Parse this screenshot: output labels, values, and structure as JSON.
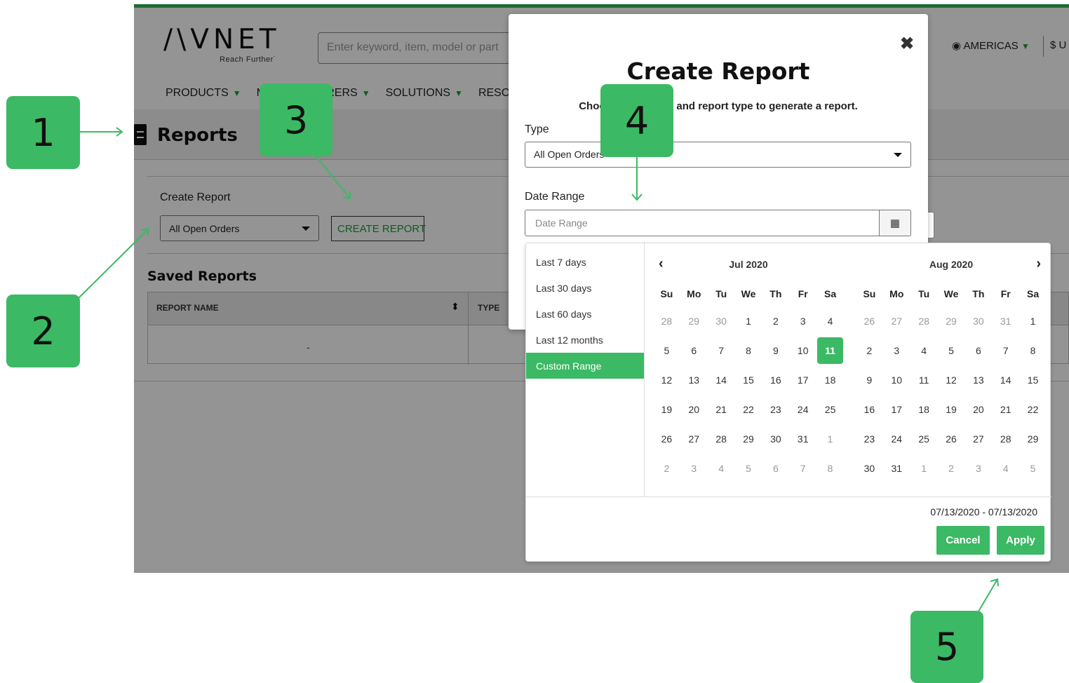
{
  "header": {
    "logo_text": "/\\VNET",
    "logo_tagline": "Reach Further˙",
    "search_placeholder": "Enter keyword, item, model or part",
    "region": "AMERICAS",
    "currency": "$ U",
    "nav": [
      "PRODUCTS",
      "MANUFACTURERS",
      "SOLUTIONS",
      "RESOURCES"
    ]
  },
  "page": {
    "title": "Reports",
    "create_label": "Create Report",
    "type_selected": "All Open Orders",
    "create_button": "CREATE REPORT",
    "saved_title": "Saved Reports",
    "table": {
      "columns": [
        "REPORT NAME",
        "TYPE"
      ],
      "empty_cell": "-"
    }
  },
  "modal": {
    "close": "✖",
    "title": "Create Report",
    "description": "Choose date range and report type to generate a report.",
    "type_label": "Type",
    "type_value": "All Open Orders",
    "date_label": "Date Range",
    "date_placeholder": "Date Range"
  },
  "picker": {
    "ranges": [
      "Last 7 days",
      "Last 30 days",
      "Last 60 days",
      "Last 12 months",
      "Custom Range"
    ],
    "active_range": "Custom Range",
    "weekdays": [
      "Su",
      "Mo",
      "Tu",
      "We",
      "Th",
      "Fr",
      "Sa"
    ],
    "left": {
      "month": "Jul 2020",
      "days": [
        "28",
        "29",
        "30",
        "1",
        "2",
        "3",
        "4",
        "5",
        "6",
        "7",
        "8",
        "9",
        "10",
        "11",
        "12",
        "13",
        "14",
        "15",
        "16",
        "17",
        "18",
        "19",
        "20",
        "21",
        "22",
        "23",
        "24",
        "25",
        "26",
        "27",
        "28",
        "29",
        "30",
        "31",
        "1",
        "2",
        "3",
        "4",
        "5",
        "6",
        "7",
        "8"
      ],
      "off": [
        0,
        1,
        2,
        34,
        35,
        36,
        37,
        38,
        39,
        40,
        41
      ],
      "selected": [
        13
      ]
    },
    "right": {
      "month": "Aug 2020",
      "days": [
        "26",
        "27",
        "28",
        "29",
        "30",
        "31",
        "1",
        "2",
        "3",
        "4",
        "5",
        "6",
        "7",
        "8",
        "9",
        "10",
        "11",
        "12",
        "13",
        "14",
        "15",
        "16",
        "17",
        "18",
        "19",
        "20",
        "21",
        "22",
        "23",
        "24",
        "25",
        "26",
        "27",
        "28",
        "29",
        "30",
        "31",
        "1",
        "2",
        "3",
        "4",
        "5"
      ],
      "off": [
        0,
        1,
        2,
        3,
        4,
        5,
        37,
        38,
        39,
        40,
        41
      ],
      "selected": []
    },
    "range_text": "07/13/2020 - 07/13/2020",
    "cancel": "Cancel",
    "apply": "Apply",
    "prev_arrow": "‹",
    "next_arrow": "›"
  },
  "callouts": [
    "1",
    "2",
    "3",
    "4",
    "5"
  ],
  "colors": {
    "accent": "#3cb964",
    "brand_dark": "#1b6e33"
  }
}
